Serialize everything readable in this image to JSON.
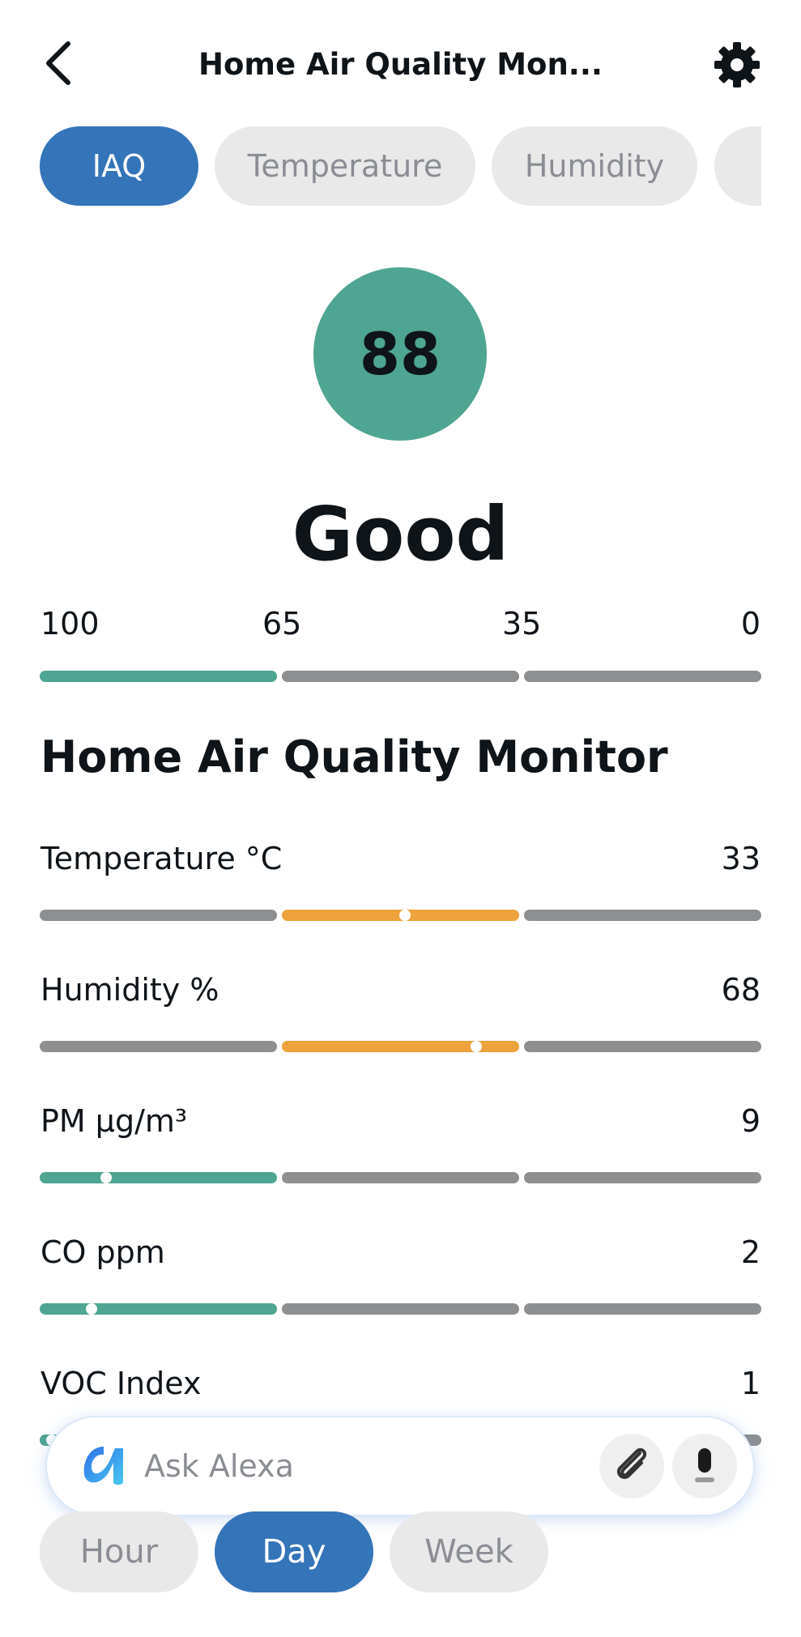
{
  "header": {
    "title": "Home Air Quality Mon...",
    "back_icon": "chevron-left-icon",
    "settings_icon": "gear-icon"
  },
  "tabs": [
    {
      "label": "IAQ",
      "active": true
    },
    {
      "label": "Temperature",
      "active": false
    },
    {
      "label": "Humidity",
      "active": false
    },
    {
      "label": "",
      "active": false
    }
  ],
  "score": {
    "value": "88",
    "rating": "Good",
    "color": "#4ea592"
  },
  "scale": {
    "labels": [
      "100",
      "65",
      "35",
      "0"
    ],
    "active_segment": 0
  },
  "section_title": "Home Air Quality Monitor",
  "metrics": [
    {
      "label": "Temperature °C",
      "value": "33",
      "active_segment": 1,
      "color": "#eea23c",
      "marker_fraction": 0.52
    },
    {
      "label": "Humidity %",
      "value": "68",
      "active_segment": 1,
      "color": "#eea23c",
      "marker_fraction": 0.82
    },
    {
      "label": "PM µg/m³",
      "value": "9",
      "active_segment": 0,
      "color": "#4ea592",
      "marker_fraction": 0.28
    },
    {
      "label": "CO ppm",
      "value": "2",
      "active_segment": 0,
      "color": "#4ea592",
      "marker_fraction": 0.22
    },
    {
      "label": "VOC Index",
      "value": "1",
      "active_segment": 0,
      "color": "#4ea592",
      "marker_fraction": 0.05
    }
  ],
  "alexa": {
    "placeholder": "Ask Alexa",
    "logo_icon": "alexa-logo-icon",
    "attach_icon": "paperclip-icon",
    "mic_icon": "microphone-icon"
  },
  "time_range": [
    {
      "label": "Hour",
      "active": false
    },
    {
      "label": "Day",
      "active": true
    },
    {
      "label": "Week",
      "active": false
    }
  ],
  "colors": {
    "accent": "#3474b9",
    "good": "#4ea592",
    "moderate": "#eea23c",
    "inactive": "#8e8f91"
  }
}
